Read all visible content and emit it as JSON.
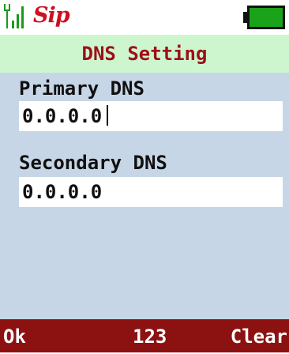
{
  "status_bar": {
    "carrier_logo": "Sip",
    "signal_icon": "signal-strength-icon",
    "battery_icon": "battery-full-icon",
    "battery_color": "#1aa21a"
  },
  "title": "DNS Setting",
  "fields": {
    "primary": {
      "label": "Primary DNS",
      "value": "0.0.0.0"
    },
    "secondary": {
      "label": "Secondary DNS",
      "value": "0.0.0.0"
    }
  },
  "softkeys": {
    "left": "Ok",
    "center": "123",
    "right": "Clear"
  },
  "colors": {
    "title_bg": "#cdf6cf",
    "title_text": "#9c1018",
    "content_bg": "#c6d6e6",
    "softkey_bg": "#8c1212"
  }
}
